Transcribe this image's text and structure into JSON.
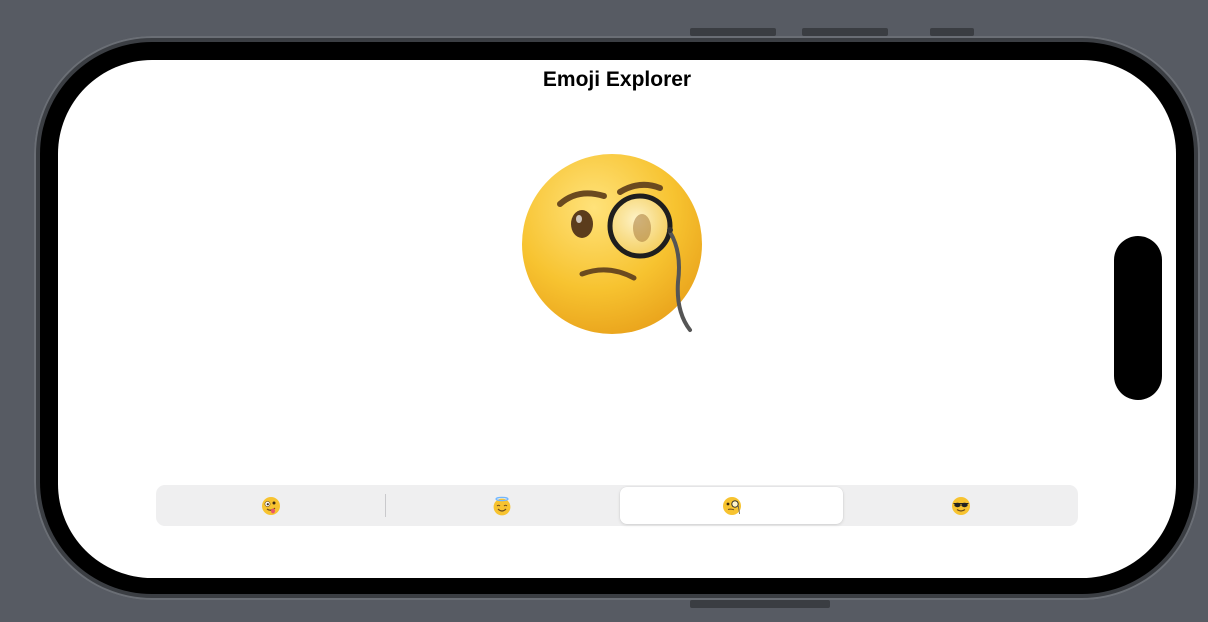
{
  "app": {
    "title": "Emoji Explorer"
  },
  "main": {
    "selected_emoji": {
      "icon": "face-with-monocle-icon",
      "char": "🧐"
    }
  },
  "segmented_control": {
    "selected_index": 2,
    "segments": [
      {
        "icon": "zany-face-icon",
        "char": "🤪"
      },
      {
        "icon": "smiling-face-with-halo-icon",
        "char": "😇"
      },
      {
        "icon": "face-with-monocle-icon",
        "char": "🧐"
      },
      {
        "icon": "smiling-face-with-sunglasses-icon",
        "char": "😎"
      }
    ]
  },
  "colors": {
    "background": "#575b63",
    "screen": "#ffffff",
    "segmented_track": "#efeff0",
    "segment_selected": "#ffffff",
    "emoji_face": "#f7c330"
  }
}
